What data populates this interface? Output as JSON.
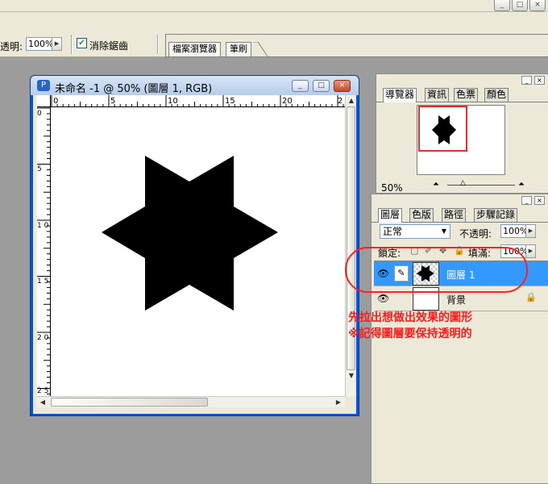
{
  "app_window": {
    "buttons": [
      "_",
      "□",
      "×"
    ]
  },
  "options_bar": {
    "opacity_label": "透明:",
    "opacity_value": "100%",
    "antialias_checked": true,
    "antialias_label": "消除鋸齒",
    "well_tabs": [
      "檔案瀏覽器",
      "筆刷"
    ]
  },
  "document": {
    "title": "未命名 -1 @ 50% (圖層 1, RGB)",
    "ruler_h": [
      "0",
      "5",
      "10",
      "15",
      "20",
      "2"
    ],
    "ruler_v": [
      "0",
      "5",
      "1 0",
      "1 5",
      "2 0",
      "2 5"
    ],
    "shape": "six-pointed star",
    "shape_color": "#000000"
  },
  "navigator_panel": {
    "tabs": [
      "導覽器",
      "資訊",
      "色票",
      "顏色"
    ],
    "active_tab": "導覽器",
    "zoom": "50%",
    "view_box_color": "#e03030"
  },
  "layers_panel": {
    "tabs": [
      "圖層",
      "色版",
      "路徑",
      "步驟記錄"
    ],
    "active_tab": "圖層",
    "blend_mode": "正常",
    "opacity_label": "不透明:",
    "opacity_value": "100%",
    "lock_label": "鎖定:",
    "fill_label": "填滿:",
    "fill_value": "100%",
    "layers": [
      {
        "name": "圖層 1",
        "selected": true,
        "selected_color": "#3399ff"
      },
      {
        "name": "背景",
        "selected": false,
        "locked": true
      }
    ]
  },
  "annotation": {
    "line1": "先拉出想做出效果的圖形",
    "line2": "※記得圖層要保持透明的",
    "color": "#ff1a1a"
  }
}
